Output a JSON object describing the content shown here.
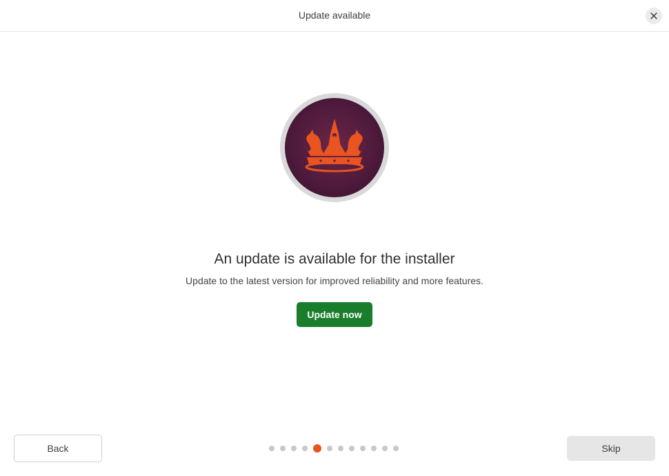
{
  "window": {
    "title": "Update available"
  },
  "header": {
    "close_icon": "close-icon"
  },
  "hero": {
    "logo_icon": "ubuntu-crown-icon",
    "headline": "An update is available for the installer",
    "subtext": "Update to the latest version for improved reliability and more features.",
    "update_button_label": "Update now"
  },
  "footer": {
    "back_label": "Back",
    "skip_label": "Skip",
    "pager": {
      "total": 12,
      "current": 5
    }
  },
  "colors": {
    "accent_orange": "#e95420",
    "primary_green": "#1a7d2c",
    "logo_background": "#5a1f45",
    "dot_inactive": "#c8c8c8"
  }
}
